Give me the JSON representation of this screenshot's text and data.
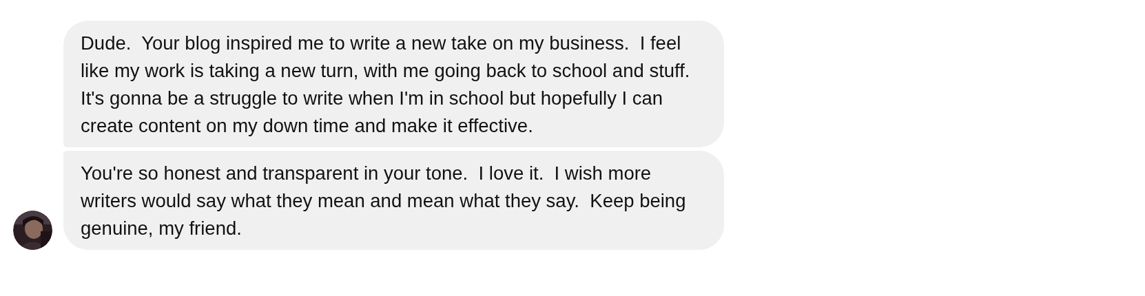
{
  "messages": [
    {
      "text": "Dude.  Your blog inspired me to write a new take on my business.  I feel like my work is taking a new turn, with me going back to school and stuff.  It's gonna be a struggle to write when I'm in school but hopefully I can create content on my down time and make it effective."
    },
    {
      "text": "You're so honest and transparent in your tone.  I love it.  I wish more writers would say what they mean and mean what they say.  Keep being genuine, my friend."
    }
  ]
}
